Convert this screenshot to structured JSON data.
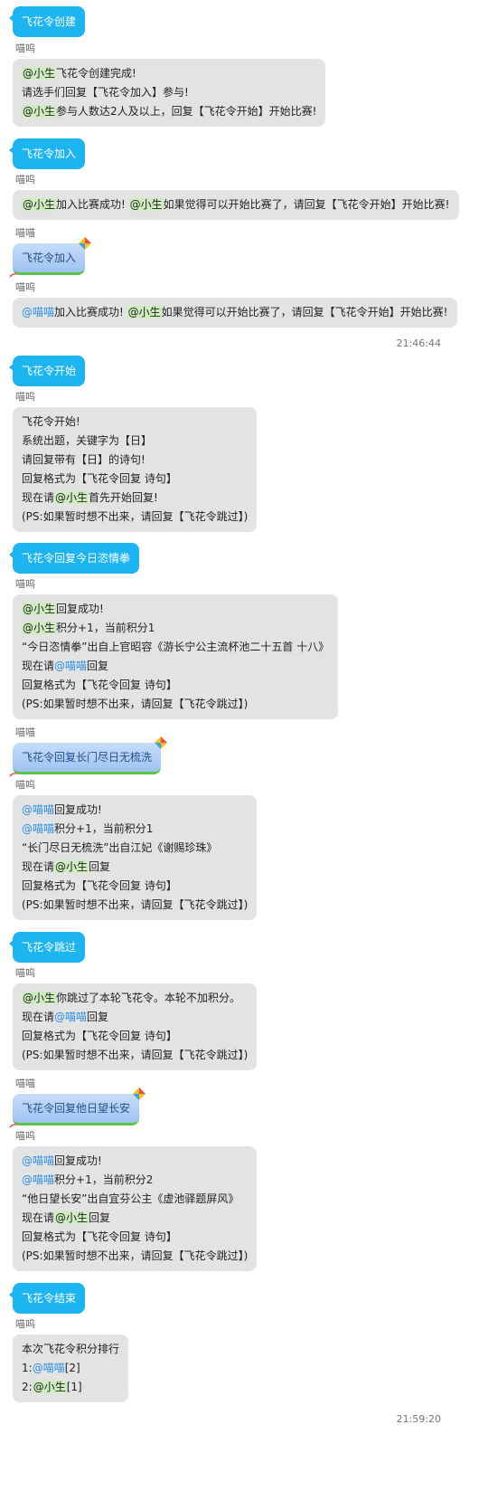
{
  "messages": [
    {
      "type": "self",
      "text": "飞花令创建"
    },
    {
      "type": "bot",
      "sender": "喵呜",
      "lines": [
        [
          {
            "m": "g",
            "t": "@小生"
          },
          {
            "t": "飞花令创建完成!"
          }
        ],
        [
          {
            "t": "请选手们回复【飞花令加入】参与!"
          }
        ],
        [
          {
            "m": "g",
            "t": "@小生"
          },
          {
            "t": "参与人数达2人及以上，回复【飞花令开始】开始比赛!"
          }
        ]
      ]
    },
    {
      "type": "self",
      "text": "飞花令加入"
    },
    {
      "type": "bot",
      "sender": "喵呜",
      "lines": [
        [
          {
            "m": "g",
            "t": "@小生"
          },
          {
            "t": "加入比赛成功! "
          },
          {
            "m": "g",
            "t": "@小生"
          },
          {
            "t": "如果觉得可以开始比赛了，请回复【飞花令开始】开始比赛!"
          }
        ]
      ]
    },
    {
      "type": "kite",
      "sender": "喵喵",
      "text": "飞花令加入"
    },
    {
      "type": "bot",
      "sender": "喵呜",
      "lines": [
        [
          {
            "m": "b",
            "t": "@喵喵"
          },
          {
            "t": "加入比赛成功! "
          },
          {
            "m": "g",
            "t": "@小生"
          },
          {
            "t": "如果觉得可以开始比赛了，请回复【飞花令开始】开始比赛!"
          }
        ]
      ]
    },
    {
      "type": "time",
      "text": "21:46:44"
    },
    {
      "type": "self",
      "text": "飞花令开始"
    },
    {
      "type": "bot",
      "sender": "喵呜",
      "lines": [
        [
          {
            "t": "飞花令开始!"
          }
        ],
        [
          {
            "t": "系统出题，关键字为【日】"
          }
        ],
        [
          {
            "t": "请回复带有【日】的诗句!"
          }
        ],
        [
          {
            "t": "回复格式为【飞花令回复 诗句】"
          }
        ],
        [
          {
            "t": "现在请"
          },
          {
            "m": "g",
            "t": "@小生"
          },
          {
            "t": "首先开始回复!"
          }
        ],
        [
          {
            "t": "(PS:如果暂时想不出来，请回复【飞花令跳过】)"
          }
        ]
      ]
    },
    {
      "type": "self",
      "text": "飞花令回复今日恣情拳"
    },
    {
      "type": "bot",
      "sender": "喵呜",
      "lines": [
        [
          {
            "m": "g",
            "t": "@小生"
          },
          {
            "t": "回复成功!"
          }
        ],
        [
          {
            "m": "g",
            "t": "@小生"
          },
          {
            "t": "积分+1，当前积分1"
          }
        ],
        [
          {
            "t": "“今日恣情拳”出自上官昭容《游长宁公主流杯池二十五首 十八》"
          }
        ],
        [
          {
            "t": "现在请"
          },
          {
            "m": "b",
            "t": "@喵喵"
          },
          {
            "t": "回复"
          }
        ],
        [
          {
            "t": "回复格式为【飞花令回复 诗句】"
          }
        ],
        [
          {
            "t": "(PS:如果暂时想不出来，请回复【飞花令跳过】)"
          }
        ]
      ]
    },
    {
      "type": "kite",
      "sender": "喵喵",
      "text": "飞花令回复长门尽日无梳洗"
    },
    {
      "type": "bot",
      "sender": "喵呜",
      "lines": [
        [
          {
            "m": "b",
            "t": "@喵喵"
          },
          {
            "t": "回复成功!"
          }
        ],
        [
          {
            "m": "b",
            "t": "@喵喵"
          },
          {
            "t": "积分+1，当前积分1"
          }
        ],
        [
          {
            "t": "“长门尽日无梳洗”出自江妃《谢赐珍珠》"
          }
        ],
        [
          {
            "t": "现在请"
          },
          {
            "m": "g",
            "t": "@小生"
          },
          {
            "t": "回复"
          }
        ],
        [
          {
            "t": "回复格式为【飞花令回复 诗句】"
          }
        ],
        [
          {
            "t": "(PS:如果暂时想不出来，请回复【飞花令跳过】)"
          }
        ]
      ]
    },
    {
      "type": "self",
      "text": "飞花令跳过"
    },
    {
      "type": "bot",
      "sender": "喵呜",
      "lines": [
        [
          {
            "m": "g",
            "t": "@小生"
          },
          {
            "t": "你跳过了本轮飞花令。本轮不加积分。"
          }
        ],
        [
          {
            "t": "现在请"
          },
          {
            "m": "b",
            "t": "@喵喵"
          },
          {
            "t": "回复"
          }
        ],
        [
          {
            "t": "回复格式为【飞花令回复 诗句】"
          }
        ],
        [
          {
            "t": "(PS:如果暂时想不出来，请回复【飞花令跳过】)"
          }
        ]
      ]
    },
    {
      "type": "kite",
      "sender": "喵喵",
      "text": "飞花令回复他日望长安"
    },
    {
      "type": "bot",
      "sender": "喵呜",
      "lines": [
        [
          {
            "m": "b",
            "t": "@喵喵"
          },
          {
            "t": "回复成功!"
          }
        ],
        [
          {
            "m": "b",
            "t": "@喵喵"
          },
          {
            "t": "积分+1，当前积分2"
          }
        ],
        [
          {
            "t": "“他日望长安”出自宜芬公主《虚池驿题屏风》"
          }
        ],
        [
          {
            "t": "现在请"
          },
          {
            "m": "g",
            "t": "@小生"
          },
          {
            "t": "回复"
          }
        ],
        [
          {
            "t": "回复格式为【飞花令回复 诗句】"
          }
        ],
        [
          {
            "t": "(PS:如果暂时想不出来，请回复【飞花令跳过】)"
          }
        ]
      ]
    },
    {
      "type": "self",
      "text": "飞花令结束"
    },
    {
      "type": "bot",
      "sender": "喵呜",
      "lines": [
        [
          {
            "t": "本次飞花令积分排行"
          }
        ],
        [
          {
            "t": "1:"
          },
          {
            "m": "b",
            "t": "@喵喵"
          },
          {
            "t": "[2]"
          }
        ],
        [
          {
            "t": "2:"
          },
          {
            "m": "g",
            "t": "@小生"
          },
          {
            "t": "[1]"
          }
        ]
      ]
    },
    {
      "type": "time",
      "text": "21:59:20"
    }
  ],
  "colors": {
    "self_bubble": "#1db4f2",
    "bot_bubble": "#e3e3e3",
    "mention_green_bg": "#cfeec0",
    "mention_blue": "#2b8fe6"
  }
}
